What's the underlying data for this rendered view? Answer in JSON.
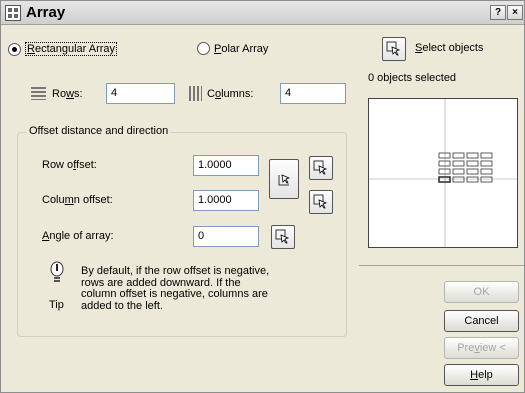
{
  "window": {
    "title": "Array",
    "help_btn": "?",
    "close_btn": "×"
  },
  "mode": {
    "rectangular": {
      "label_u": "R",
      "label_rest": "ectangular Array",
      "selected": true
    },
    "polar": {
      "label_u": "P",
      "label_rest": "olar Array",
      "selected": false
    }
  },
  "select_objects": {
    "label_u": "S",
    "label_rest": "elect objects",
    "status": "0 objects selected"
  },
  "rows": {
    "label_pre": "Ro",
    "label_u": "w",
    "label_post": "s:",
    "value": "4"
  },
  "columns": {
    "label_pre": "C",
    "label_u": "o",
    "label_post": "lumns:",
    "value": "4"
  },
  "offset_group": {
    "title": "Offset distance and direction",
    "row_offset": {
      "label_pre": "Row o",
      "label_u": "f",
      "label_post": "fset:",
      "value": "1.0000"
    },
    "column_offset": {
      "label_pre": "Colu",
      "label_u": "m",
      "label_post": "n offset:",
      "value": "1.0000"
    },
    "angle": {
      "label_pre": "",
      "label_u": "A",
      "label_post": "ngle of array:",
      "value": "0"
    }
  },
  "tip": {
    "caption": "Tip",
    "text_lines": [
      "By default, if the row offset is negative,",
      "rows are added downward.  If the",
      "column offset is negative, columns are",
      "added to the left."
    ]
  },
  "buttons": {
    "ok": "OK",
    "cancel": "Cancel",
    "preview_pre": "Pre",
    "preview_u": "v",
    "preview_post": "iew <",
    "help_u": "H",
    "help_post": "elp"
  },
  "preview_grid": {
    "rows": 4,
    "columns": 4
  }
}
